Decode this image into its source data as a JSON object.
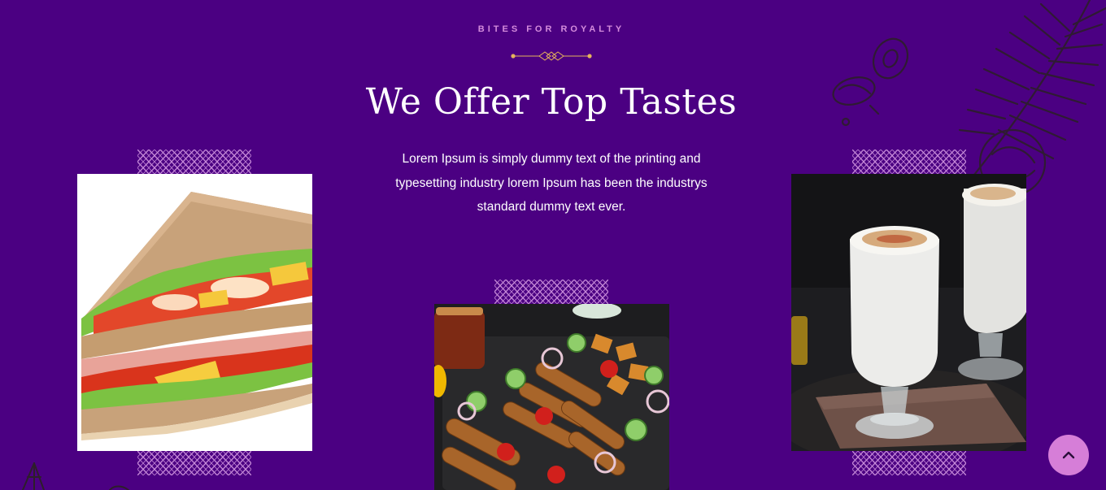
{
  "section": {
    "eyebrow": "BITES FOR ROYALTY",
    "title": "We Offer Top Tastes",
    "description": "Lorem Ipsum is simply dummy text of the printing and typesetting industry lorem Ipsum has been the industrys standard dummy text ever."
  },
  "gallery": {
    "items": [
      {
        "subject": "sandwich"
      },
      {
        "subject": "kebab platter"
      },
      {
        "subject": "lassi"
      }
    ]
  },
  "icons": {
    "scroll_top": "chevron-up-icon",
    "divider": "diamond-divider-icon",
    "decoration": "spice-leaf-illustration"
  },
  "colors": {
    "background": "#4b0082",
    "accent": "#d48bdc",
    "gold": "#e6b35c",
    "scroll_button": "#d67ed8"
  }
}
